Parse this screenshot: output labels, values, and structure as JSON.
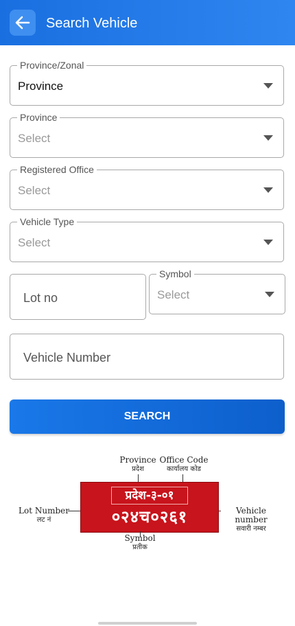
{
  "header": {
    "title": "Search Vehicle",
    "back_icon": "arrow-left-icon"
  },
  "form": {
    "province_zonal": {
      "label": "Province/Zonal",
      "value": "Province"
    },
    "province": {
      "label": "Province",
      "value": "Select"
    },
    "registered_office": {
      "label": "Registered Office",
      "value": "Select"
    },
    "vehicle_type": {
      "label": "Vehicle Type",
      "value": "Select"
    },
    "lot_no": {
      "placeholder": "Lot no"
    },
    "symbol": {
      "label": "Symbol",
      "value": "Select"
    },
    "vehicle_number": {
      "placeholder": "Vehicle Number"
    },
    "search_label": "SEARCH"
  },
  "plate_diagram": {
    "plate_top": "प्रदेश-३-०१",
    "plate_bottom": "०२४च०२६१",
    "province_label": "Province",
    "province_label_np": "प्रदेश",
    "office_code_label": "Office Code",
    "office_code_label_np": "कार्यालय कोड",
    "lot_number_label": "Lot Number",
    "lot_number_label_np": "लट नं",
    "vehicle_number_label": "Vehicle number",
    "vehicle_number_label_np": "सवारी नम्बर",
    "symbol_label": "Symbol",
    "symbol_label_np": "प्रतीक"
  },
  "colors": {
    "primary": "#1a6fe0",
    "plate_red": "#c8141c"
  }
}
